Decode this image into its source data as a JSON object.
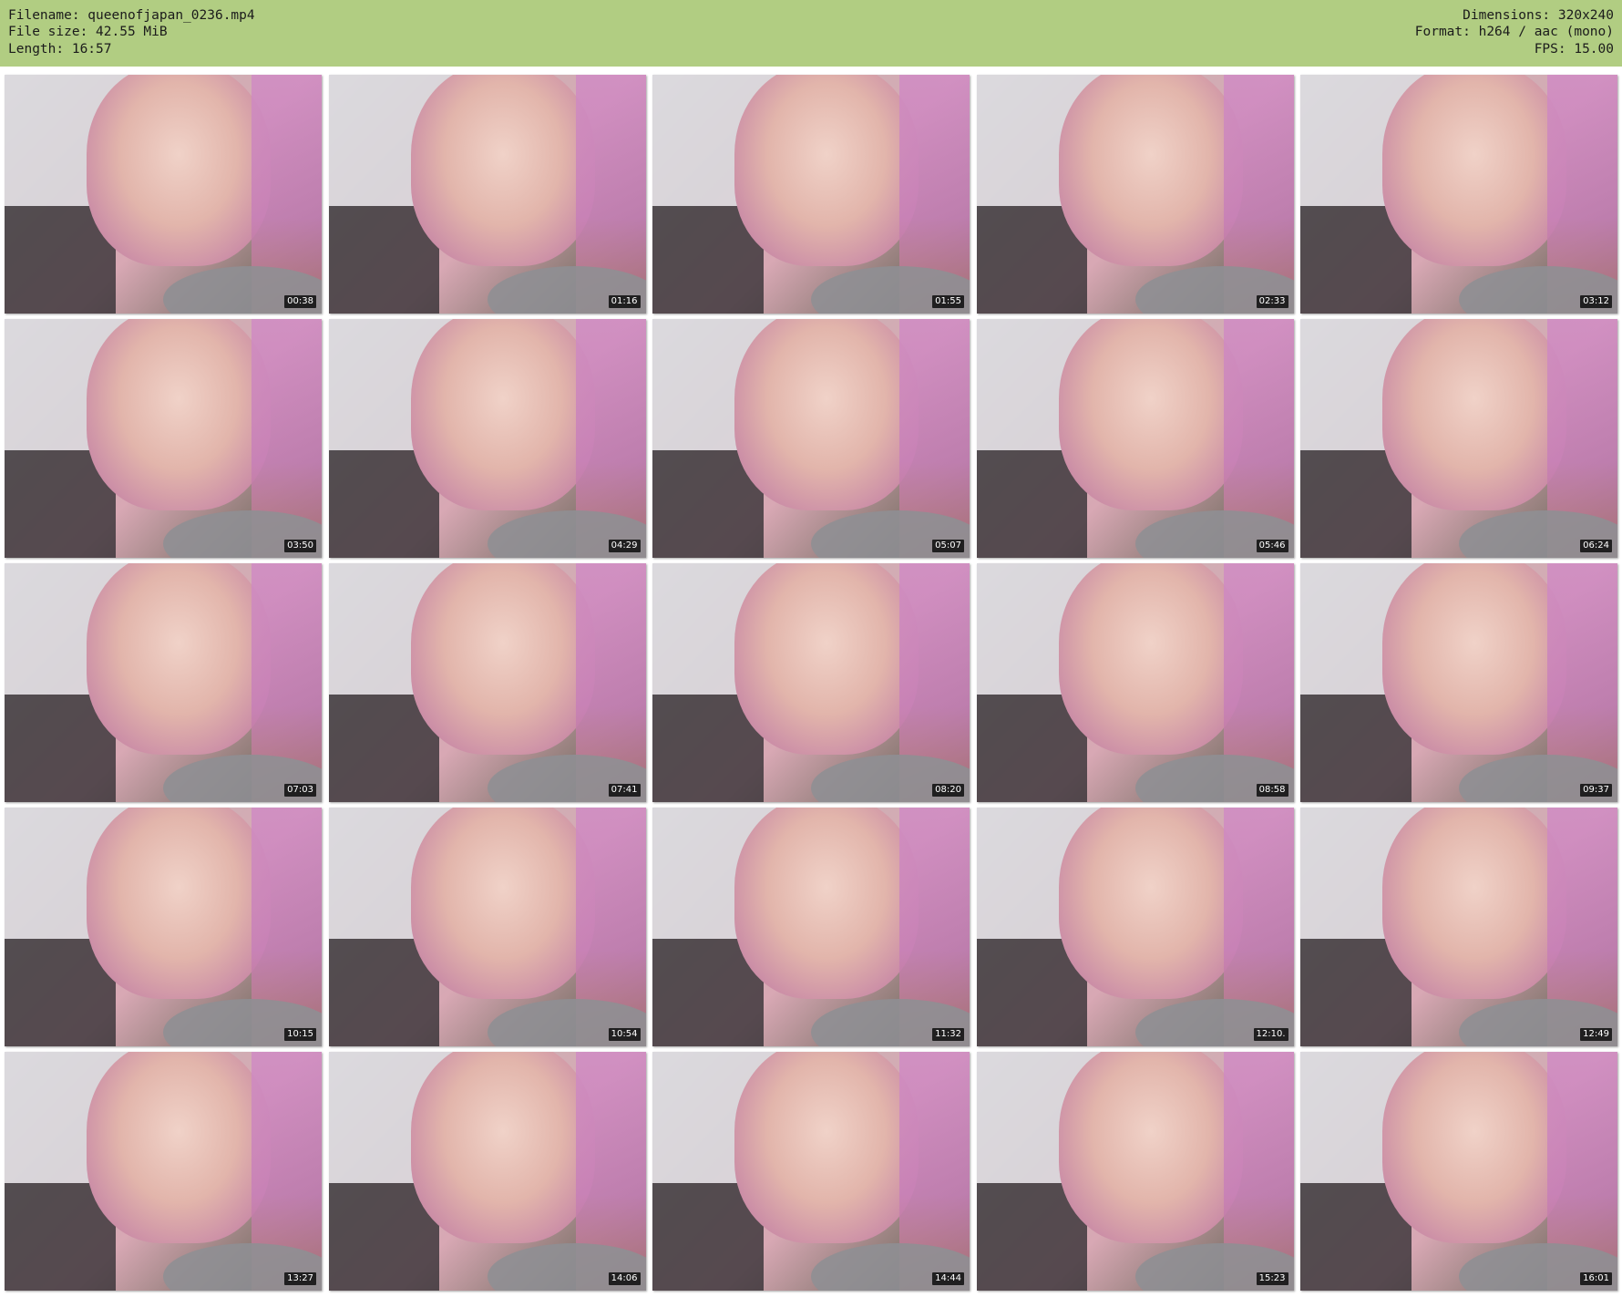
{
  "header": {
    "filename": "Filename: queenofjapan_0236.mp4",
    "filesize": "File size: 42.55 MiB",
    "length": "Length: 16:57",
    "dimensions": "Dimensions: 320x240",
    "format": "Format: h264 / aac (mono)",
    "fps": "FPS: 15.00"
  },
  "colors": {
    "header_bg": "#b1cd82",
    "timestamp_bg": "#000000"
  },
  "thumbnails": [
    {
      "time": "00:38"
    },
    {
      "time": "01:16"
    },
    {
      "time": "01:55"
    },
    {
      "time": "02:33"
    },
    {
      "time": "03:12"
    },
    {
      "time": "03:50"
    },
    {
      "time": "04:29"
    },
    {
      "time": "05:07"
    },
    {
      "time": "05:46"
    },
    {
      "time": "06:24"
    },
    {
      "time": "07:03"
    },
    {
      "time": "07:41"
    },
    {
      "time": "08:20"
    },
    {
      "time": "08:58"
    },
    {
      "time": "09:37"
    },
    {
      "time": "10:15"
    },
    {
      "time": "10:54"
    },
    {
      "time": "11:32"
    },
    {
      "time": "12:10."
    },
    {
      "time": "12:49"
    },
    {
      "time": "13:27"
    },
    {
      "time": "14:06"
    },
    {
      "time": "14:44"
    },
    {
      "time": "15:23"
    },
    {
      "time": "16:01"
    }
  ]
}
